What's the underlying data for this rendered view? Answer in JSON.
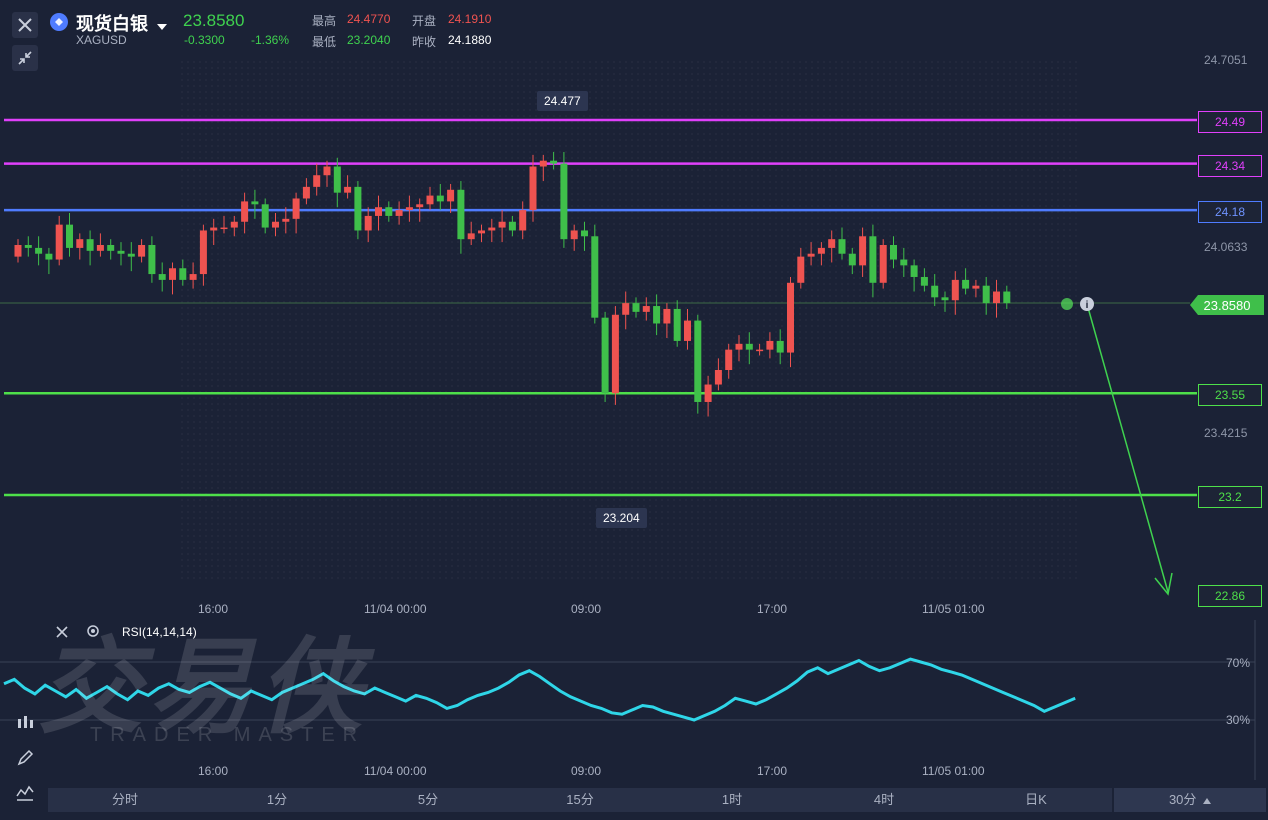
{
  "header": {
    "title": "现货白银",
    "symbol": "XAGUSD",
    "price": "23.8580",
    "change": "-0.3300",
    "change_pct": "-1.36%",
    "high_label": "最高",
    "high_value": "24.4770",
    "low_label": "最低",
    "low_value": "23.2040",
    "open_label": "开盘",
    "open_value": "24.1910",
    "prev_close_label": "昨收",
    "prev_close_value": "24.1880"
  },
  "price_axis": [
    "24.7051",
    "24.0633",
    "23.4215"
  ],
  "levels": [
    {
      "value": 24.49,
      "label": "24.49",
      "color": "#e040fb"
    },
    {
      "value": 24.34,
      "label": "24.34",
      "color": "#e040fb"
    },
    {
      "value": 24.18,
      "label": "24.18",
      "color": "#4f7cff"
    },
    {
      "value": 23.55,
      "label": "23.55",
      "color": "#4ee04a"
    },
    {
      "value": 23.2,
      "label": "23.2",
      "color": "#4ee04a"
    }
  ],
  "projection_label": "22.86",
  "current_price_tag": "23.8580",
  "callouts": {
    "high": "24.477",
    "low": "23.204"
  },
  "time_axis": [
    "16:00",
    "11/04 00:00",
    "09:00",
    "17:00",
    "11/05 01:00"
  ],
  "rsi": {
    "label": "RSI(14,14,14)",
    "upper": "70%",
    "lower": "30%",
    "line_color": "#2fd6e8"
  },
  "watermark": {
    "cn": "交易侠",
    "en": "TRADER MASTER"
  },
  "bottom_tabs": [
    "分时",
    "1分",
    "5分",
    "15分",
    "1时",
    "4时",
    "日K"
  ],
  "period_selector": "30分",
  "colors": {
    "up": "#ef5350",
    "down": "#3fbf4a",
    "background": "#1b2236"
  },
  "icons": [
    "close-icon",
    "shrink-icon",
    "silver-coin-icon",
    "dropdown-caret-icon",
    "settings-gear-icon",
    "candlestick-icon",
    "pencil-icon",
    "indicator-icon"
  ]
}
